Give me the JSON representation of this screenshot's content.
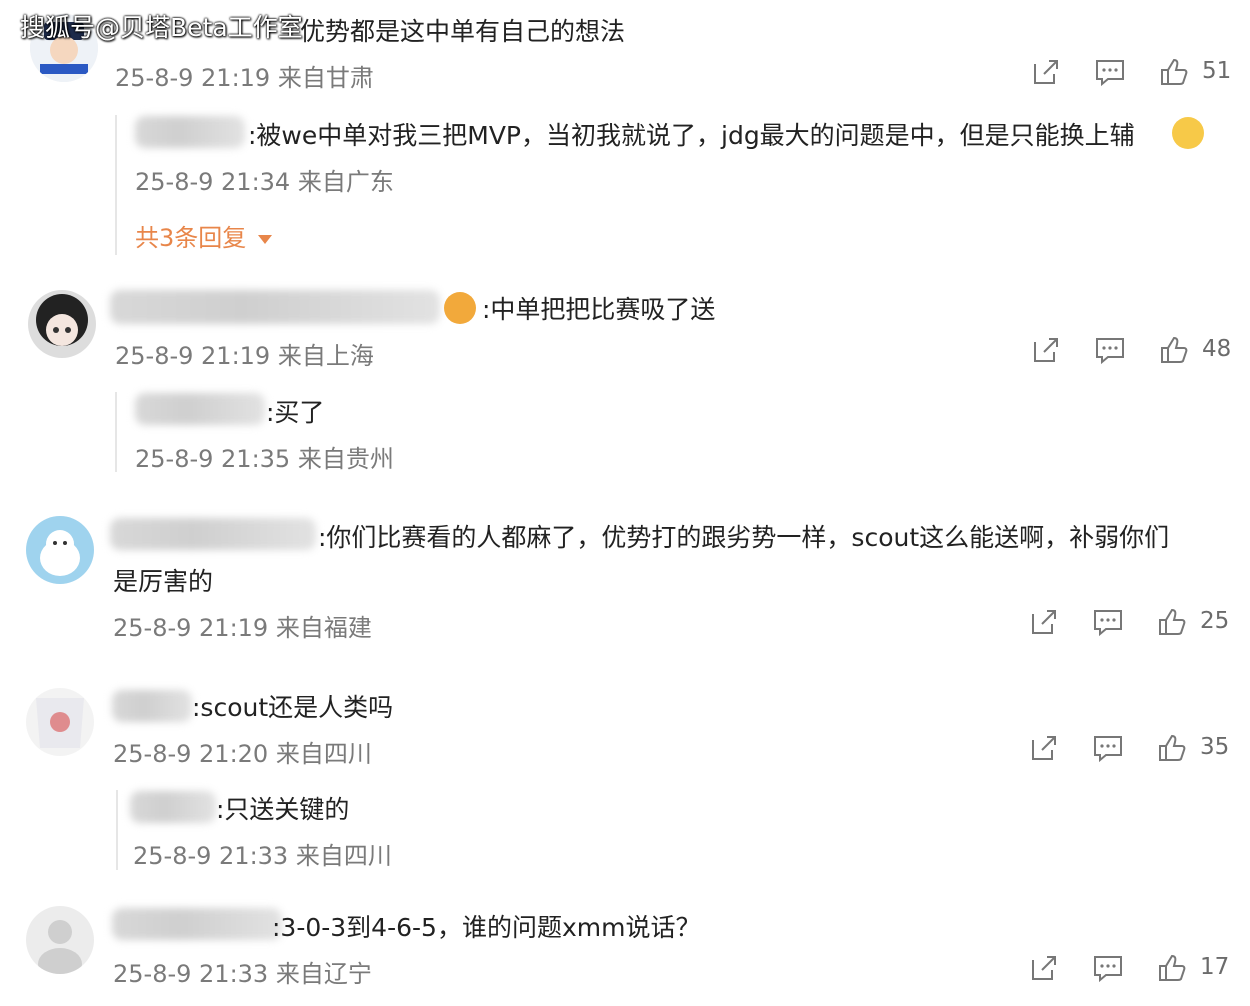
{
  "watermark": "搜狐号@贝塔Beta工作室",
  "comments": [
    {
      "text": "优势都是这中单有自己的想法",
      "meta": "25-8-9 21:19 来自甘肃",
      "share_icon": "share-icon",
      "comment_icon": "comment-icon",
      "likes": "51",
      "reply": {
        "text": ":被we中单对我三把MVP，当初我就说了，jdg最大的问题是中，但是只能换上辅",
        "meta": "25-8-9 21:34 来自广东"
      },
      "more_replies": "共3条回复"
    },
    {
      "text": ":中单把把比赛吸了送",
      "meta": "25-8-9 21:19 来自上海",
      "likes": "48",
      "reply": {
        "text": ":买了",
        "meta": "25-8-9 21:35 来自贵州"
      }
    },
    {
      "text_line1": ":你们比赛看的人都麻了，优势打的跟劣势一样，scout这么能送啊，补弱你们",
      "text_line2": "是厉害的",
      "meta": "25-8-9 21:19 来自福建",
      "likes": "25"
    },
    {
      "text": ":scout还是人类吗",
      "meta": "25-8-9 21:20 来自四川",
      "likes": "35",
      "reply": {
        "text": ":只送关键的",
        "meta": "25-8-9 21:33 来自四川"
      }
    },
    {
      "text": ":3-0-3到4-6-5，谁的问题xmm说话？",
      "meta": "25-8-9 21:33 来自辽宁",
      "likes": "17"
    }
  ]
}
